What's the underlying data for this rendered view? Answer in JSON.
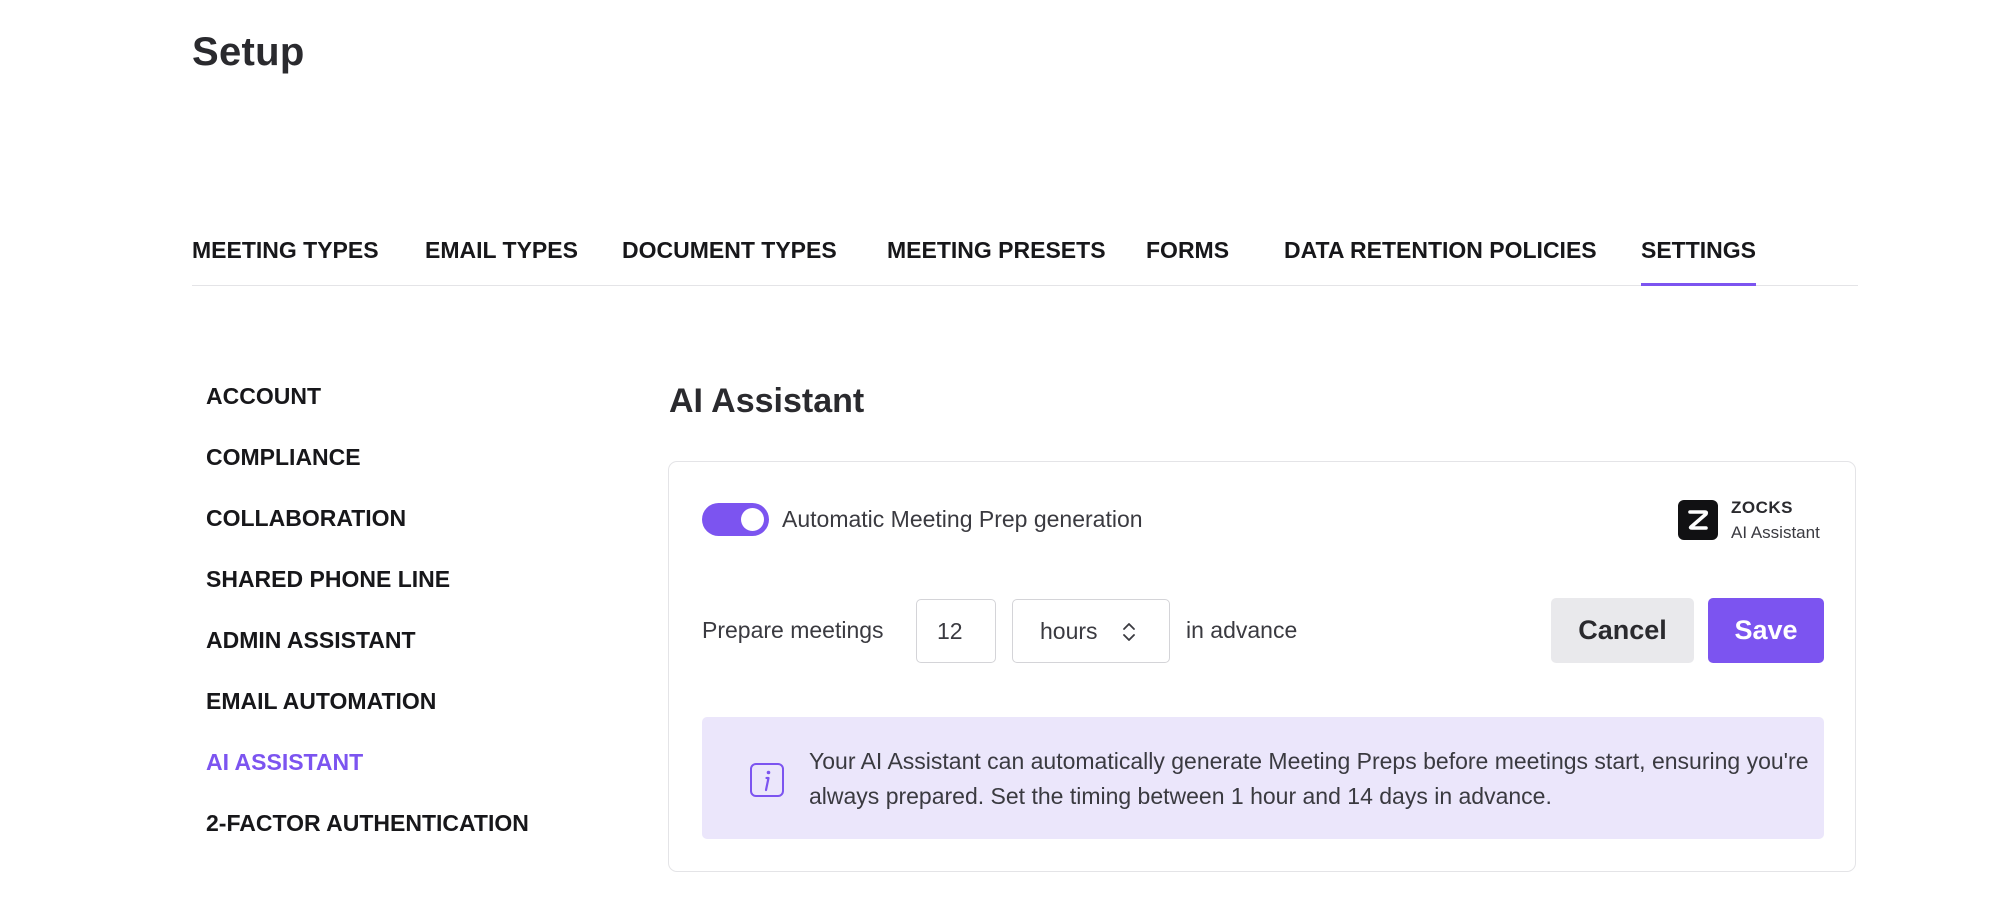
{
  "page": {
    "title": "Setup"
  },
  "tabs": [
    {
      "label": "MEETING TYPES"
    },
    {
      "label": "EMAIL TYPES"
    },
    {
      "label": "DOCUMENT TYPES"
    },
    {
      "label": "MEETING PRESETS"
    },
    {
      "label": "FORMS"
    },
    {
      "label": "DATA RETENTION POLICIES"
    },
    {
      "label": "SETTINGS",
      "active": true
    }
  ],
  "sidebar": {
    "items": [
      {
        "label": "ACCOUNT"
      },
      {
        "label": "COMPLIANCE"
      },
      {
        "label": "COLLABORATION"
      },
      {
        "label": "SHARED PHONE LINE"
      },
      {
        "label": "ADMIN ASSISTANT"
      },
      {
        "label": "EMAIL AUTOMATION"
      },
      {
        "label": "AI ASSISTANT",
        "active": true
      },
      {
        "label": "2-FACTOR AUTHENTICATION"
      }
    ]
  },
  "main": {
    "title": "AI Assistant",
    "toggle": {
      "label": "Automatic Meeting Prep generation",
      "enabled": true
    },
    "brand": {
      "name": "ZOCKS",
      "subtitle": "AI Assistant"
    },
    "prep": {
      "label": "Prepare meetings",
      "value": "12",
      "unit": "hours",
      "suffix": "in advance"
    },
    "buttons": {
      "cancel": "Cancel",
      "save": "Save"
    },
    "info": {
      "icon": "info-icon",
      "text": "Your AI Assistant can automatically generate Meeting Preps before meetings start, ensuring you're always prepared. Set the timing between 1 hour and 14 days in advance."
    }
  },
  "colors": {
    "accent": "#7c54f0",
    "info_background": "#ebe6fb",
    "cancel_background": "#e9e9ec"
  }
}
